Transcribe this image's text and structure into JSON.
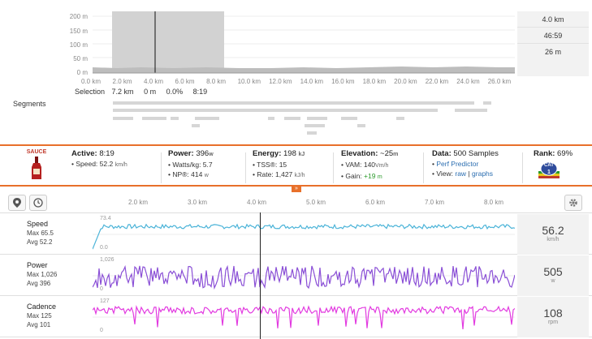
{
  "top_chart": {
    "y_ticks": [
      "200 m",
      "150 m",
      "100 m",
      "50 m",
      "0 m"
    ],
    "x_ticks": [
      "0.0 km",
      "2.0 km",
      "4.0 km",
      "6.0 km",
      "8.0 km",
      "10.0 km",
      "12.0 km",
      "14.0 km",
      "16.0 km",
      "18.0 km",
      "20.0 km",
      "22.0 km",
      "24.0 km",
      "26.0 km"
    ],
    "readout": [
      "4.0 km",
      "46:59",
      "26 m"
    ]
  },
  "selection": {
    "label": "Selection",
    "distance": "7.2 km",
    "elevation": "0 m",
    "grade": "0.0%",
    "time": "8:19"
  },
  "segments_label": "Segments",
  "sauce": {
    "logo_text": "SAUCE",
    "active_label": "Active:",
    "active_value": "8:19",
    "speed_line": "• Speed: 52.2",
    "speed_unit": "km/h",
    "power_label": "Power:",
    "power_value": "396",
    "power_unit": "w",
    "wkg_line": "• Watts/kg: 5.7",
    "np_line": "• NP®: 414",
    "np_unit": "w",
    "energy_label": "Energy:",
    "energy_value": "198",
    "energy_unit": "kJ",
    "tss_line": "• TSS®: 15",
    "rate_line": "• Rate: 1,427",
    "rate_unit": "kJ/h",
    "elev_label": "Elevation:",
    "elev_value": "~25",
    "elev_unit": "m",
    "vam_line": "• VAM: 140",
    "vam_unit": "Vm/h",
    "gain_prefix": "• Gain:",
    "gain_value": "+19",
    "gain_unit": "m",
    "data_label": "Data:",
    "data_value": "500 Samples",
    "predictor_prefix": "•",
    "predictor_link": "Perf Predictor",
    "view_prefix": "• View:",
    "view_raw": "raw",
    "view_sep": "|",
    "view_graphs": "graphs",
    "rank_label": "Rank:",
    "rank_value": "69%",
    "badge_text": "CAT",
    "badge_num": "1"
  },
  "streams_x_ticks": [
    "2.0 km",
    "3.0 km",
    "4.0 km",
    "5.0 km",
    "6.0 km",
    "7.0 km",
    "8.0 km"
  ],
  "rows": [
    {
      "title": "Speed",
      "max": "Max 65.5",
      "avg": "Avg 52.2",
      "axis_max": "73.4",
      "axis_min": "0.0",
      "value": "56.2",
      "unit": "km/h",
      "color": "#4ab3d8"
    },
    {
      "title": "Power",
      "max": "Max 1,026",
      "avg": "Avg 396",
      "axis_max": "1,026",
      "axis_min": "0",
      "value": "505",
      "unit": "w",
      "color": "#8a4fd6"
    },
    {
      "title": "Cadence",
      "max": "Max 125",
      "avg": "Avg 101",
      "axis_max": "127",
      "axis_min": "0",
      "value": "108",
      "unit": "rpm",
      "color": "#e23ae0"
    }
  ]
}
